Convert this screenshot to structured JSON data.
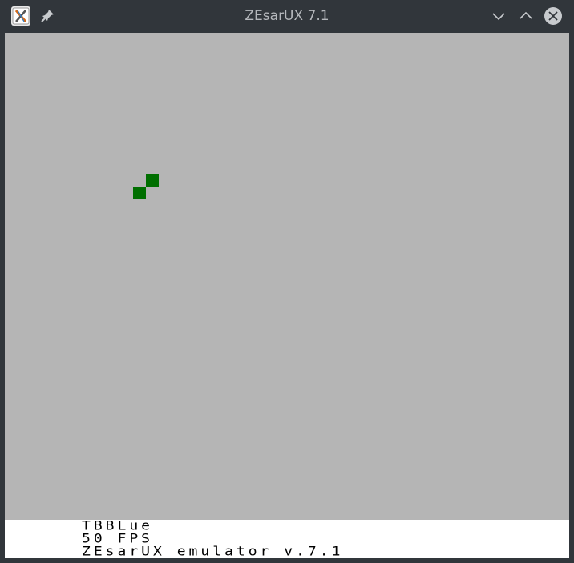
{
  "window": {
    "title": "ZEsarUX 7.1"
  },
  "titlebar_icons": {
    "app": "zesarux-app-icon",
    "pin": "pin-icon",
    "minimize": "chevron-down-icon",
    "maximize": "chevron-up-icon",
    "close": "close-icon"
  },
  "screen": {
    "background": "#b5b5b5",
    "block_color": "#006f00"
  },
  "status": {
    "machine": "TBBLue",
    "fps": "50 FPS",
    "version": "ZEsarUX emulator v.7.1"
  },
  "colors": {
    "titlebar": "#31363b",
    "title_text": "#b5b8bc",
    "status_bg": "#ffffff",
    "status_text": "#000000"
  }
}
